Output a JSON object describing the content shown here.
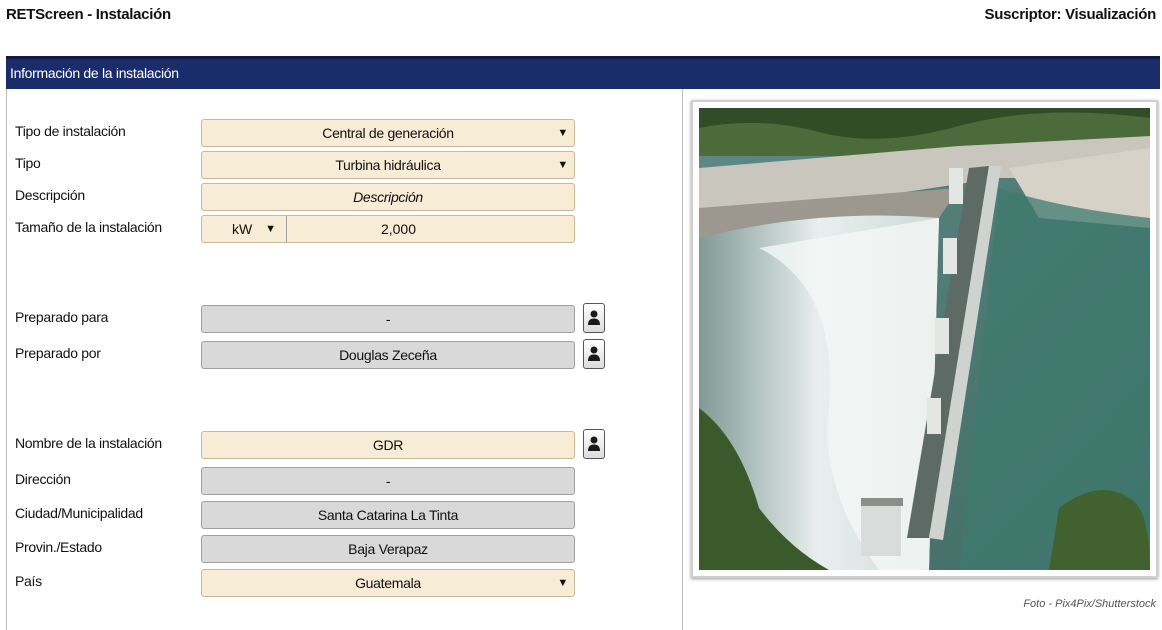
{
  "window": {
    "app_title": "RETScreen - Instalación",
    "subscriber": "Suscriptor: Visualización"
  },
  "section": {
    "title": "Información de la instalación"
  },
  "form": {
    "facility_type": {
      "label": "Tipo de instalación",
      "value": "Central de generación"
    },
    "type": {
      "label": "Tipo",
      "value": "Turbina hidráulica"
    },
    "description": {
      "label": "Descripción",
      "placeholder": "Descripción"
    },
    "facility_size": {
      "label": "Tamaño de la instalación",
      "unit": "kW",
      "value": "2,000"
    },
    "prepared_for": {
      "label": "Preparado para",
      "value": "-"
    },
    "prepared_by": {
      "label": "Preparado por",
      "value": "Douglas Zeceña"
    },
    "facility_name": {
      "label": "Nombre de la instalación",
      "value": "GDR"
    },
    "address": {
      "label": "Dirección",
      "value": "-"
    },
    "city": {
      "label": "Ciudad/Municipalidad",
      "value": "Santa Catarina La Tinta"
    },
    "province": {
      "label": "Provin./Estado",
      "value": "Baja Verapaz"
    },
    "country": {
      "label": "País",
      "value": "Guatemala"
    }
  },
  "icons": {
    "dropdown": "dropdown-caret-icon",
    "contact": "contact-person-icon"
  },
  "photo": {
    "credit": "Foto - Pix4Pix/Shutterstock"
  },
  "colors": {
    "header_bar": "#1b2c6b",
    "input_cream": "#f7ecd6",
    "input_gray": "#d9d9d9"
  }
}
